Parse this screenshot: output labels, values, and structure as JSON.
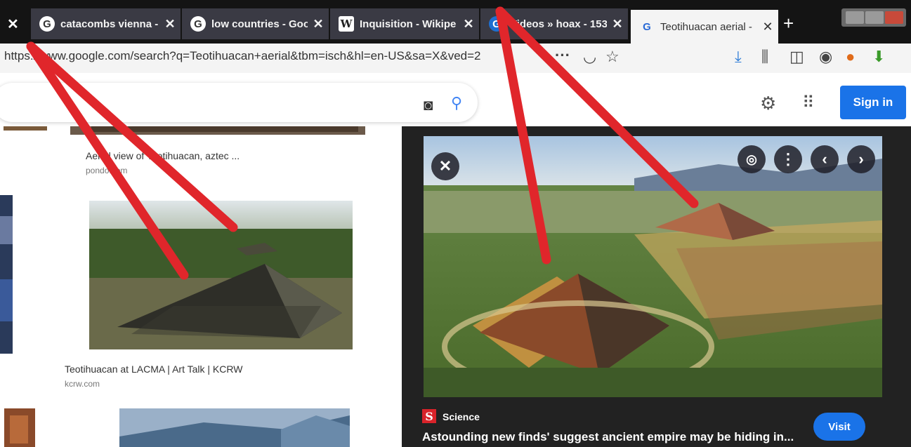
{
  "tabs": [
    {
      "title": "catacombs vienna -",
      "icon": "G"
    },
    {
      "title": "low countries - Goo",
      "icon": "G"
    },
    {
      "title": "Inquisition - Wikipe",
      "icon": "W"
    },
    {
      "title": "Videos » hoax - 153",
      "icon": "G"
    },
    {
      "title": "Teotihuacan aerial -",
      "icon": "G"
    }
  ],
  "toolbar": {
    "url": "https://www.google.com/search?q=Teotihuacan+aerial&tbm=isch&hl=en-US&sa=X&ved=2",
    "more": "···"
  },
  "header": {
    "sign_in": "Sign in"
  },
  "results": [
    {
      "title": "Aerial view of Teotihuacan, aztec ...",
      "source": "pondo.com"
    },
    {
      "title": "Teotihuacan at LACMA | Art Talk | KCRW",
      "source": "kcrw.com"
    }
  ],
  "preview": {
    "source": "Science",
    "source_letter": "S",
    "caption": "Astounding new finds' suggest ancient empire may be hiding in...",
    "visit_label": "Visit"
  },
  "colors": {
    "annotation": "#e0262b",
    "accent": "#1a73e8"
  }
}
